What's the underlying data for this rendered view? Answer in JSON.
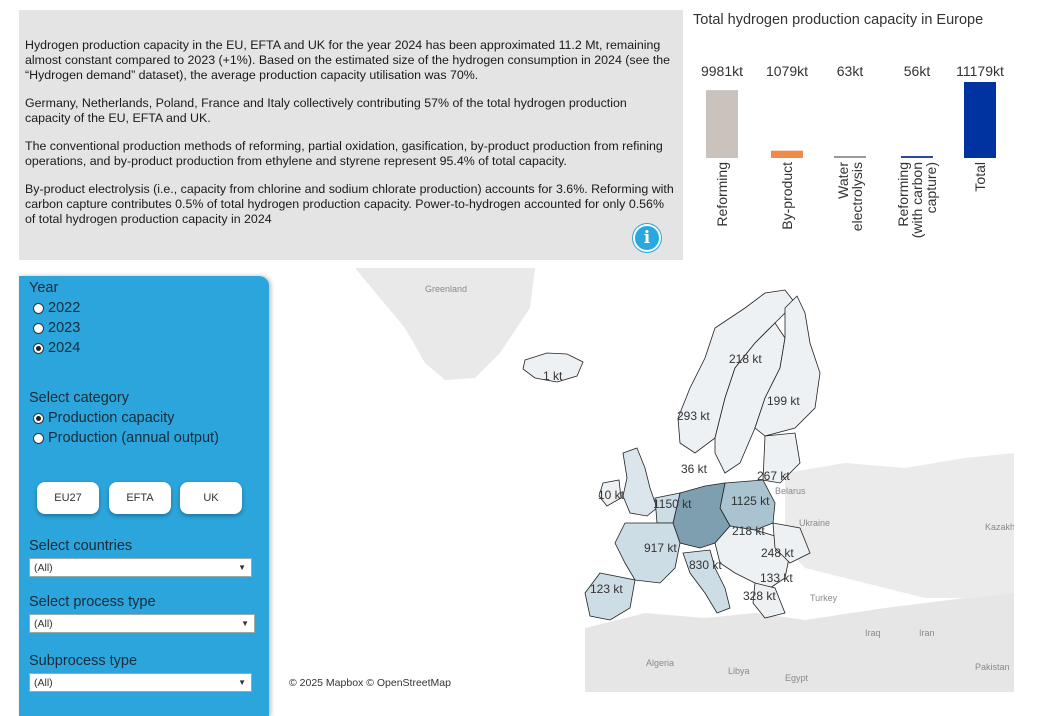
{
  "summary": {
    "p1": "Hydrogen production capacity in the EU, EFTA and UK for the year 2024 has been approximated 11.2 Mt, remaining almost constant compared to 2023 (+1%). Based on the estimated size of the hydrogen consumption in 2024 (see the “Hydrogen demand” dataset), the average production capacity utilisation was 70%.",
    "p2": "Germany, Netherlands, Poland, France and Italy collectively contributing 57% of the total hydrogen production capacity of the EU, EFTA and UK.",
    "p3": "The conventional production methods of reforming, partial oxidation, gasification, by-product production from refining operations, and by-product production from ethylene and styrene represent 95.4% of total capacity.",
    "p4": "By-product electrolysis (i.e., capacity from chlorine and sodium chlorate production) accounts for 3.6%. Reforming with carbon capture contributes 0.5% of total hydrogen production capacity. Power-to-hydrogen accounted for only 0.56% of total hydrogen production capacity in 2024",
    "info_icon": "info-icon",
    "info_symbol": "i"
  },
  "chart_data": {
    "type": "bar",
    "title": "Total hydrogen production capacity in Europe",
    "categories": [
      "Reforming",
      "By-product",
      "Water electrolysis",
      "Reforming (with carbon capture)",
      "Total"
    ],
    "category_lines": [
      [
        "Reforming"
      ],
      [
        "By-product"
      ],
      [
        "Water",
        "electrolysis"
      ],
      [
        "Reforming",
        "(with carbon",
        "capture)"
      ],
      [
        "Total"
      ]
    ],
    "values": [
      9981,
      1079,
      63,
      56,
      11179
    ],
    "data_labels": [
      "9981kt",
      "1079kt",
      "63kt",
      "56kt",
      "11179kt"
    ],
    "unit": "kt",
    "colors": [
      "#c9c2bd",
      "#f28a4a",
      "#9a9a9a",
      "#2a4a9a",
      "#0033a0"
    ],
    "ylim": [
      0,
      11179
    ]
  },
  "sidebar": {
    "year": {
      "heading": "Year",
      "options": [
        {
          "label": "2022",
          "checked": false
        },
        {
          "label": "2023",
          "checked": false
        },
        {
          "label": "2024",
          "checked": true
        }
      ]
    },
    "category": {
      "heading": "Select category",
      "options": [
        {
          "label": "Production capacity",
          "checked": true
        },
        {
          "label": "Production (annual output)",
          "checked": false
        }
      ]
    },
    "region_buttons": [
      "EU27",
      "EFTA",
      "UK"
    ],
    "countries": {
      "heading": "Select countries",
      "value": "(All)"
    },
    "process": {
      "heading": "Select process type",
      "value": "(All)"
    },
    "subprocess": {
      "heading": "Subprocess type",
      "value": "(All)"
    }
  },
  "map": {
    "place_labels": [
      "Greenland",
      "Belarus",
      "Ukraine",
      "Kazakh",
      "Turkey",
      "Iraq",
      "Iran",
      "Algeria",
      "Libya",
      "Egypt",
      "Pakistan"
    ],
    "value_labels": [
      "1 kt",
      "218 kt",
      "199 kt",
      "293 kt",
      "36 kt",
      "267 kt",
      "10 kt",
      "1150 kt",
      "1125 kt",
      "218 kt",
      "917 kt",
      "248 kt",
      "830 kt",
      "133 kt",
      "123 kt",
      "328 kt"
    ],
    "attribution": "© 2025 Mapbox © OpenStreetMap",
    "colors": {
      "land": "#e7e7e7",
      "region": "#eef1f4",
      "high": "#7d9fb0",
      "mid": "#a9c3d0",
      "low": "#cddde6"
    }
  }
}
